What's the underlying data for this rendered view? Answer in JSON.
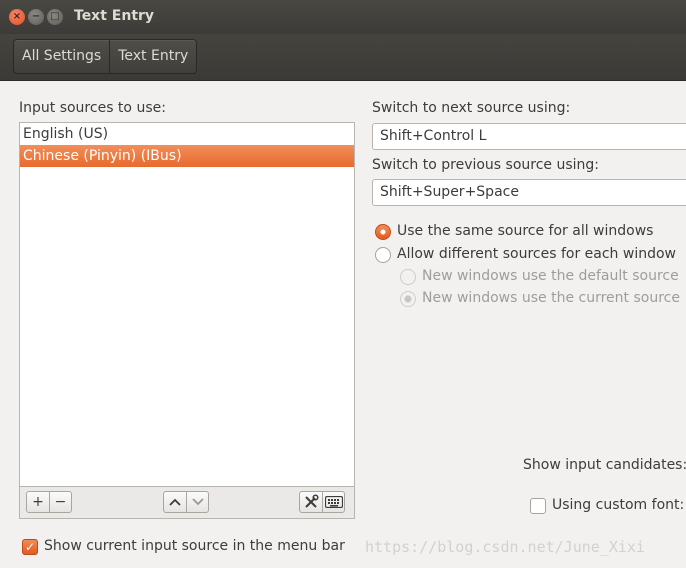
{
  "window": {
    "title": "Text Entry"
  },
  "breadcrumbs": [
    {
      "label": "All Settings"
    },
    {
      "label": "Text Entry"
    }
  ],
  "input_sources": {
    "heading": "Input sources to use:",
    "items": [
      {
        "label": "English (US)",
        "selected": false
      },
      {
        "label": "Chinese (Pinyin) (IBus)",
        "selected": true
      }
    ],
    "toolbar": {
      "add": "+",
      "remove": "−",
      "up": "^",
      "down": "v"
    }
  },
  "switch_next": {
    "label": "Switch to next source using:",
    "value": "Shift+Control L"
  },
  "switch_prev": {
    "label": "Switch to previous source using:",
    "value": "Shift+Super+Space"
  },
  "source_mode": {
    "same": {
      "label": "Use the same source for all windows",
      "checked": true
    },
    "different": {
      "label": "Allow different sources for each window",
      "checked": false
    },
    "new_default": {
      "label": "New windows use the default source",
      "checked": false,
      "disabled": true
    },
    "new_current": {
      "label": "New windows use the current source",
      "checked": true,
      "disabled": true
    }
  },
  "candidates": {
    "label": "Show input candidates:"
  },
  "custom_font": {
    "label": "Using custom font:",
    "checked": false
  },
  "menu_bar": {
    "label": "Show current input source in the menu bar",
    "checked": true
  },
  "watermark": "https://blog.csdn.net/June_Xixi",
  "colors": {
    "accent": "#e9692d",
    "titlebar": "#3c3b37",
    "background": "#f2f1f0"
  },
  "icons": {
    "settings": "tools-icon",
    "keyboard": "keyboard-icon"
  }
}
